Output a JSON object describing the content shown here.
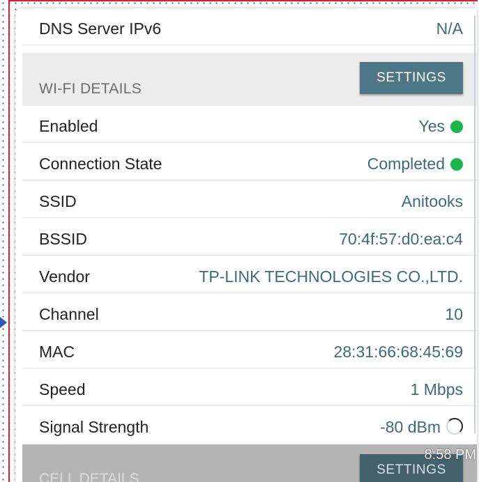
{
  "network": {
    "dns_ipv6": {
      "label": "DNS Server IPv6",
      "value": "N/A"
    }
  },
  "wifi": {
    "section_title": "WI-FI DETAILS",
    "settings_label": "SETTINGS",
    "rows": [
      {
        "label": "Enabled",
        "value": "Yes",
        "indicator": "green-dot"
      },
      {
        "label": "Connection State",
        "value": "Completed",
        "indicator": "green-dot"
      },
      {
        "label": "SSID",
        "value": "Anitooks"
      },
      {
        "label": "BSSID",
        "value": "70:4f:57:d0:ea:c4"
      },
      {
        "label": "Vendor",
        "value": "TP-LINK TECHNOLOGIES CO.,LTD."
      },
      {
        "label": "Channel",
        "value": "10"
      },
      {
        "label": "MAC",
        "value": "28:31:66:68:45:69"
      },
      {
        "label": "Speed",
        "value": "1 Mbps"
      },
      {
        "label": "Signal Strength",
        "value": "-80 dBm",
        "indicator": "signal-ring"
      }
    ]
  },
  "cell": {
    "section_title": "CELL DETAILS",
    "settings_label": "SETTINGS"
  },
  "status_bar": {
    "time": "8:58 PM"
  },
  "colors": {
    "accent_button": "#4e7786",
    "value_text": "#3d6a7a",
    "status_green": "#18b74b",
    "section_header_bg": "#ececec"
  }
}
